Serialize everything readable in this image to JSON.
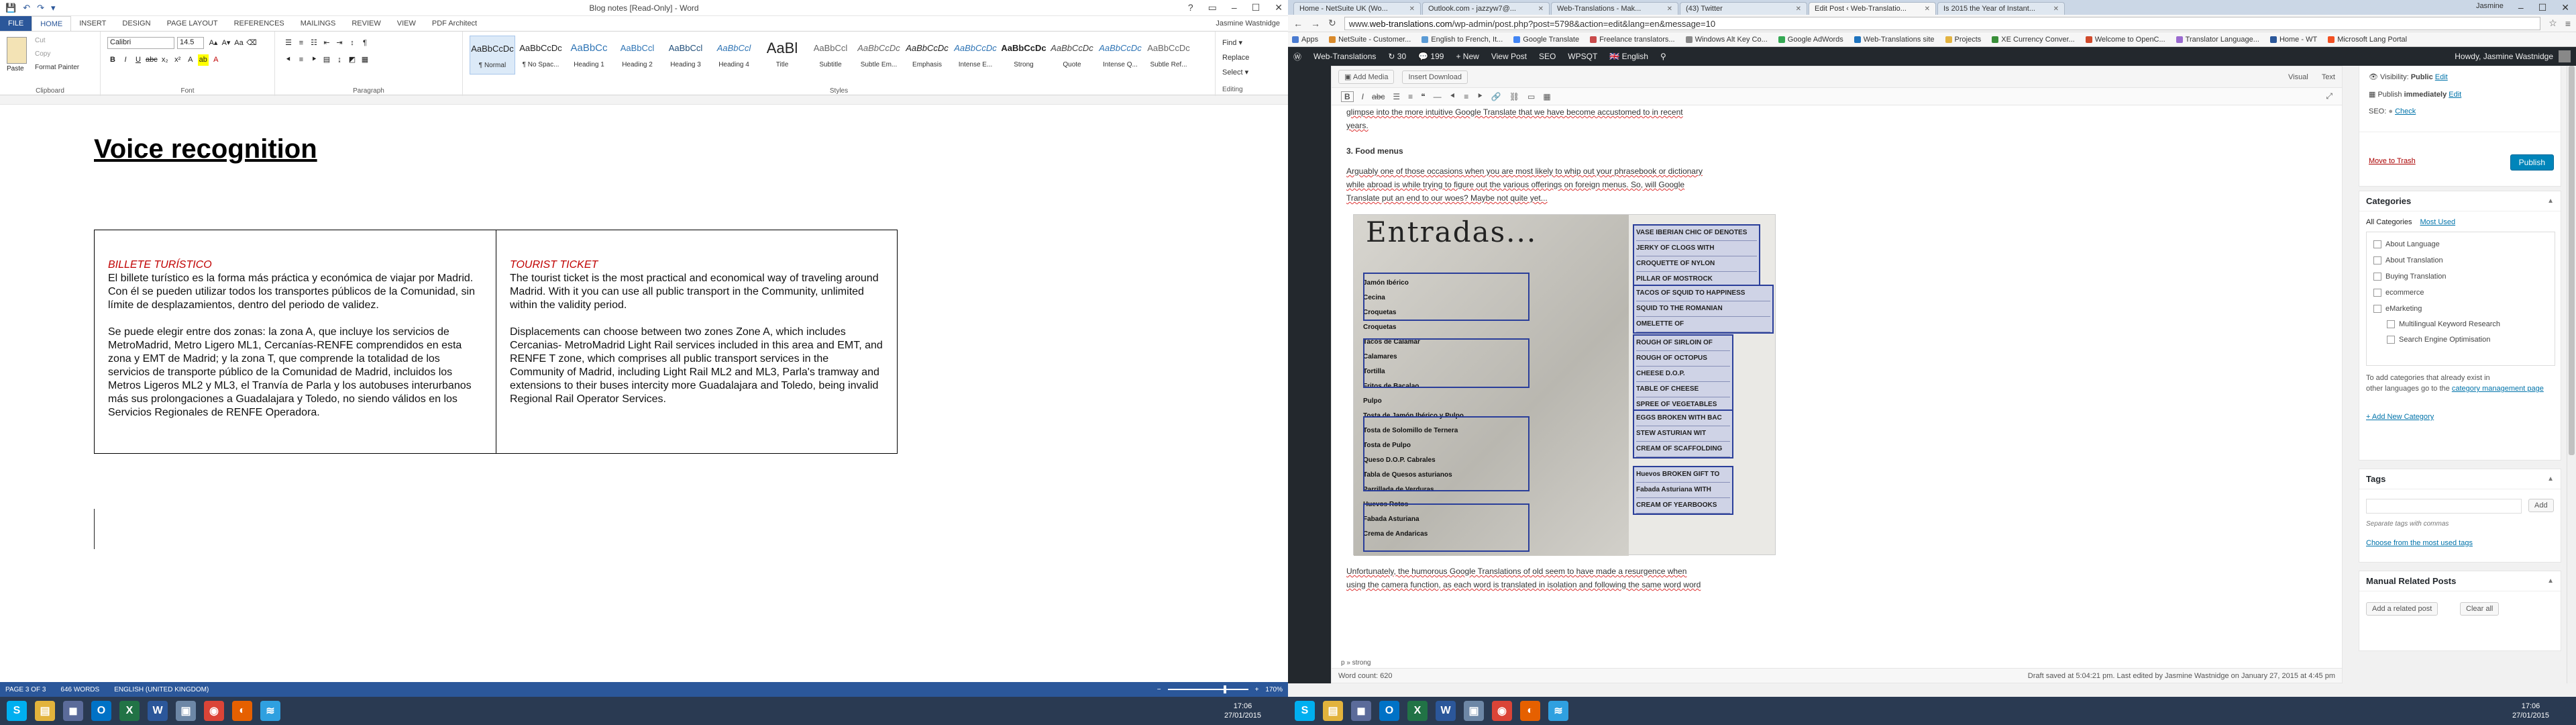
{
  "word": {
    "title": "Blog notes [Read-Only] - Word",
    "qat": [
      "💾",
      "↶",
      "↷",
      "▾"
    ],
    "win_buttons": [
      "?",
      "▭",
      "–",
      "☐",
      "✕"
    ],
    "tabs": [
      "FILE",
      "HOME",
      "INSERT",
      "DESIGN",
      "PAGE LAYOUT",
      "REFERENCES",
      "MAILINGS",
      "REVIEW",
      "VIEW",
      "PDF Architect"
    ],
    "user": "Jasmine Wastnidge",
    "clipboard": {
      "paste": "Paste",
      "cut": "Cut",
      "copy": "Copy",
      "format_painter": "Format Painter",
      "label": "Clipboard"
    },
    "font": {
      "name": "Calibri",
      "size": "14.5",
      "label": "Font"
    },
    "paragraph_label": "Paragraph",
    "styles_label": "Styles",
    "editing_label": "Editing",
    "styles": [
      {
        "preview": "AaBbCcDc",
        "name": "¶ Normal"
      },
      {
        "preview": "AaBbCcDc",
        "name": "¶ No Spac..."
      },
      {
        "preview": "AaBbCc",
        "name": "Heading 1"
      },
      {
        "preview": "AaBbCcl",
        "name": "Heading 2"
      },
      {
        "preview": "AaBbCcl",
        "name": "Heading 3"
      },
      {
        "preview": "AaBbCcl",
        "name": "Heading 4"
      },
      {
        "preview": "AaBl",
        "name": "Title"
      },
      {
        "preview": "AaBbCcl",
        "name": "Subtitle"
      },
      {
        "preview": "AaBbCcDc",
        "name": "Subtle Em..."
      },
      {
        "preview": "AaBbCcDc",
        "name": "Emphasis"
      },
      {
        "preview": "AaBbCcDc",
        "name": "Intense E..."
      },
      {
        "preview": "AaBbCcDc",
        "name": "Strong"
      },
      {
        "preview": "AaBbCcDc",
        "name": "Quote"
      },
      {
        "preview": "AaBbCcDc",
        "name": "Intense Q..."
      },
      {
        "preview": "AaBbCcDc",
        "name": "Subtle Ref..."
      }
    ],
    "editing": [
      "Find ▾",
      "Replace",
      "Select ▾"
    ],
    "heading": "Voice recognition",
    "table": {
      "left_head": "BILLETE TURÍSTICO",
      "left_p1": "El billete turístico es la forma más práctica y económica de viajar por Madrid. Con él se pueden utilizar todos los transportes públicos de la Comunidad, sin límite de desplazamientos, dentro del periodo de validez.",
      "left_p2": "Se puede elegir entre dos zonas: la zona A, que incluye los servicios de MetroMadrid, Metro Ligero ML1, Cercanías-RENFE comprendidos en esta zona y EMT de Madrid; y la zona T, que comprende la totalidad de los servicios de transporte público de la Comunidad de Madrid, incluidos los Metros Ligeros ML2 y ML3, el Tranvía de Parla y los autobuses interurbanos más sus prolongaciones a Guadalajara y Toledo, no siendo válidos en los Servicios Regionales de RENFE Operadora.",
      "right_head": "TOURIST TICKET",
      "right_p1": "The tourist ticket is the most practical and economical way of traveling around Madrid. With it you can use all public transport in the Community, unlimited within the validity period.",
      "right_p2": "Displacements can choose between two zones Zone A, which includes Cercanias- MetroMadrid Light Rail services included in this area and EMT, and RENFE T zone, which comprises all public transport services in the Community of Madrid, including Light Rail ML2 and ML3, Parla's tramway and extensions to their buses intercity more Guadalajara and Toledo, being invalid Regional Rail Operator Services."
    },
    "status": {
      "page": "PAGE 3 OF 3",
      "words": "646 WORDS",
      "lang": "ENGLISH (UNITED KINGDOM)",
      "zoom": "170%"
    },
    "zoom_fraction": 0.72
  },
  "chrome": {
    "tabs": [
      {
        "label": "Home - NetSuite UK (Wo..."
      },
      {
        "label": "Outlook.com - jazzyw7@..."
      },
      {
        "label": "Web-Translations - Mak..."
      },
      {
        "label": "(43) Twitter"
      },
      {
        "label": "Edit Post ‹ Web-Translatio..."
      },
      {
        "label": "Is 2015 the Year of Instant..."
      }
    ],
    "user_name": "Jasmine",
    "url_prefix": "www.",
    "url_domain": "web-translations.com",
    "url_path": "/wp-admin/post.php?post=5798&action=edit&lang=en&message=10",
    "bookmarks": [
      "Apps",
      "NetSuite - Customer...",
      "English to French, It...",
      "Google Translate",
      "Freelance translators...",
      "Windows Alt Key Co...",
      "Google AdWords",
      "Web-Translations site",
      "Projects",
      "XE Currency Conver...",
      "Welcome to OpenC...",
      "Translator Language...",
      "Home - WT",
      "Microsoft Lang Portal"
    ],
    "adminbar": {
      "site": "Web-Translations",
      "updates": "30",
      "comments": "199",
      "new": "+ New",
      "view": "View Post",
      "seo": "SEO",
      "wpsqt": "WPSQT",
      "lang": "English",
      "howdy": "Howdy, Jasmine Wastnidge"
    }
  },
  "wp": {
    "add_media": "Add Media",
    "insert_download": "Insert Download",
    "mode_visual": "Visual",
    "mode_text": "Text",
    "para_top_1": "glimpse into the more intuitive Google Translate that we have become accustomed to in recent",
    "para_top_2": "years.",
    "h_food": "3. Food menus",
    "para_food_1": "Arguably one of those occasions when you are most likely to whip out your phrasebook or dictionary",
    "para_food_2": "while abroad is while trying to figure out the various offerings on foreign menus. So, will Google",
    "para_food_3": "Translate put an end to our woes? Maybe not quite yet...",
    "image": {
      "title": "Entradas...",
      "menu_lines": [
        "Jamón Ibérico",
        "Cecina",
        "Croquetas",
        "Croquetas",
        "Tacos de Calamar",
        "Calamares",
        "Tortilla",
        "Fritos de Bacalao",
        "Pulpo",
        "Tosta de Jamón Ibérico y Pulpo",
        "Tosta de Solomillo de Ternera",
        "Tosta de Pulpo",
        "Queso D.O.P. Cabrales",
        "Tabla de Quesos asturianos",
        "Parrillada de Verduras",
        "Huevos Rotos",
        "Fabada Asturiana",
        "Crema de Andaricas"
      ],
      "translations_1": [
        "VASE IBERIAN CHIC OF DENOTES",
        "JERKY OF CLOGS WITH",
        "CROQUETTE OF NYLON",
        "PILLAR OF MOSTROCK"
      ],
      "translations_2": [
        "TACOS OF SQUID TO HAPPINESS",
        "SQUID TO THE ROMANIAN",
        "OMELETTE OF",
        "ROUGH OF SIRLOIN OF",
        "ROUGH OF OCTOPUS",
        "CHEESE D.O.P.",
        "TABLE OF CHEESE",
        "SPREE OF VEGETABLES"
      ],
      "translations_3": [
        "EGGS BROKEN WITH BAC",
        "STEW ASTURIAN WIT",
        "CREAM OF SCAFFOLDING"
      ],
      "translations_4": [
        "Huevos BROKEN GIFT TO",
        "Fabada Asturiana WITH",
        "CREAM OF YEARBOOKS"
      ]
    },
    "para_bottom_1": "Unfortunately, the humorous Google Translations of old seem to have made a resurgence when",
    "para_bottom_2": "using the camera function, as each word is translated in isolation and following the same word word",
    "path": "p » strong",
    "word_count": "Word count: 620",
    "draft": "Draft saved at 5:04:21 pm. Last edited by Jasmine Wastnidge on January 27, 2015 at 4:45 pm",
    "publish": {
      "visibility_label": "Visibility:",
      "visibility_value": "Public",
      "visibility_edit": "Edit",
      "publish_label": "Publish",
      "publish_value": "immediately",
      "publish_edit": "Edit",
      "seo_label": "SEO:",
      "seo_value": "Check",
      "trash": "Move to Trash",
      "button": "Publish"
    },
    "categories": {
      "title": "Categories",
      "tab_all": "All Categories",
      "tab_used": "Most Used",
      "items": [
        "About Language",
        "About Translation",
        "Buying Translation",
        "ecommerce",
        "eMarketing",
        "Multilingual Keyword Research",
        "Search Engine Optimisation"
      ],
      "note_1": "To add categories that already exist in",
      "note_2": "other languages go to the",
      "note_link": "category management page",
      "add_new": "+ Add New Category"
    },
    "tags": {
      "title": "Tags",
      "add": "Add",
      "hint": "Separate tags with commas",
      "choose": "Choose from the most used tags"
    },
    "related": {
      "title": "Manual Related Posts",
      "add": "Add a related post",
      "clear": "Clear all"
    }
  },
  "taskbar_left": {
    "clock_time": "17:06",
    "clock_date": "27/01/2015"
  },
  "taskbar_right": {
    "clock_time": "17:06",
    "clock_date": "27/01/2015"
  },
  "taskbar_icons": [
    {
      "name": "skype",
      "glyph": "S",
      "color": "#00aff0"
    },
    {
      "name": "explorer",
      "glyph": "▤",
      "color": "#e2b33c"
    },
    {
      "name": "app",
      "glyph": "◼",
      "color": "#5b6b9a"
    },
    {
      "name": "outlook",
      "glyph": "O",
      "color": "#0072c6"
    },
    {
      "name": "excel",
      "glyph": "X",
      "color": "#217346"
    },
    {
      "name": "word",
      "glyph": "W",
      "color": "#2b579a"
    },
    {
      "name": "app2",
      "glyph": "▣",
      "color": "#6d87a6"
    },
    {
      "name": "chrome",
      "glyph": "◉",
      "color": "#db4437"
    },
    {
      "name": "firefox",
      "glyph": "◐",
      "color": "#e66000"
    },
    {
      "name": "wifi",
      "glyph": "≋",
      "color": "#2fa0e0"
    }
  ]
}
